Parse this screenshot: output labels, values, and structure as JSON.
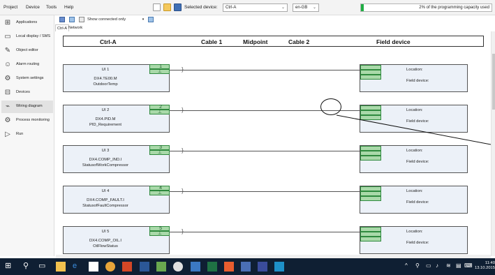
{
  "menu": [
    "Project",
    "Device",
    "Tools",
    "Help"
  ],
  "toolbar": {
    "selected_device_label": "Selected device:",
    "selected_device_value": "Ctrl-A",
    "language_value": "en-GB",
    "capacity_text": "2% of the programming capacity used",
    "capacity_percent": 2,
    "capacity_color": "#1fae44"
  },
  "sidebar": {
    "items": [
      {
        "label": "Applications",
        "icon": "applications-icon"
      },
      {
        "label": "Local display / SMS",
        "icon": "display-icon"
      },
      {
        "label": "Object editor",
        "icon": "pencil-icon"
      },
      {
        "label": "Alarm routing",
        "icon": "people-icon"
      },
      {
        "label": "System settings",
        "icon": "gear-icon"
      },
      {
        "label": "Devices",
        "icon": "network-icon"
      },
      {
        "label": "Wiring diagram",
        "icon": "wiring-icon"
      },
      {
        "label": "Process monitoring",
        "icon": "process-icon"
      },
      {
        "label": "Run",
        "icon": "play-icon"
      }
    ],
    "active_index": 6
  },
  "subtoolbar": {
    "filter_label": "Show connected only"
  },
  "tabs": [
    "Ctrl-A",
    "Network"
  ],
  "columns": {
    "ctrl": "Ctrl-A",
    "cable1": "Cable 1",
    "midpoint": "Midpoint",
    "cable2": "Cable 2",
    "field": "Field device"
  },
  "rows": [
    {
      "ui": "UI 1",
      "terminal": "1",
      "ground": "⊥",
      "line1": "DX4.TE00.M",
      "line2": "OutdoorTemp",
      "location_label": "Location:",
      "field_label": "Field device:"
    },
    {
      "ui": "UI 2",
      "terminal": "2",
      "ground": "⊥",
      "line1": "DX4.PID.M",
      "line2": "PID_Requirement",
      "location_label": "Location:",
      "field_label": "Field device:"
    },
    {
      "ui": "UI 3",
      "terminal": "3",
      "ground": "⊥",
      "line1": "DX4.COMP_IND.I",
      "line2": "StatusofWorkCompressor",
      "location_label": "Location:",
      "field_label": "Field device:"
    },
    {
      "ui": "UI 4",
      "terminal": "4",
      "ground": "⊥",
      "line1": "DX4.COMP_FAULT.I",
      "line2": "StatusofFaultCompressor",
      "location_label": "Location:",
      "field_label": "Field device:"
    },
    {
      "ui": "UI 5",
      "terminal": "5",
      "ground": "⊥",
      "line1": "DX4.COMP_OIL.I",
      "line2": "OilFlowStatus",
      "location_label": "Location:",
      "field_label": "Field device:"
    }
  ],
  "taskbar": {
    "time": "11:40",
    "date": "13.10.2015"
  }
}
